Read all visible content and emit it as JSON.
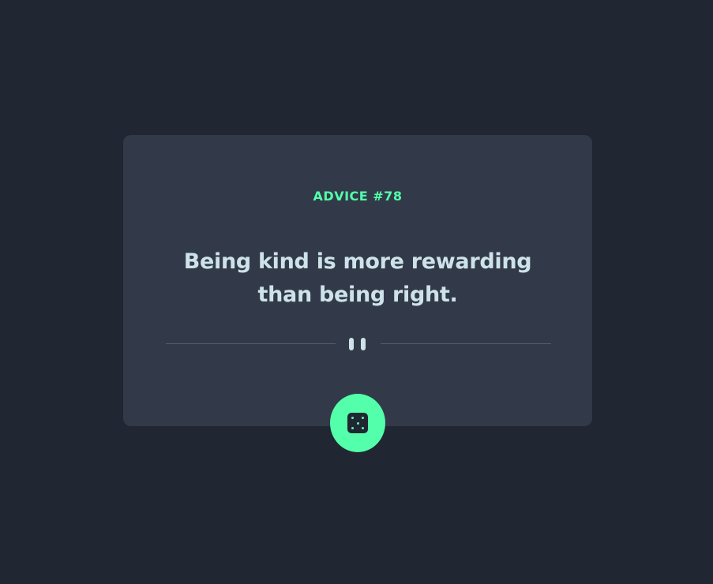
{
  "card": {
    "advice_id": "ADVICE #78",
    "advice_text": "Being kind is more rewarding than being right."
  },
  "divider": {
    "icon": "pause-icon"
  },
  "dice_button": {
    "icon": "dice-icon",
    "accent_color": "#53ffaa"
  },
  "colors": {
    "background": "#202632",
    "card": "#323a49",
    "accent": "#53ffaa",
    "text": "#cee3e9",
    "divider": "#4f5d74"
  }
}
